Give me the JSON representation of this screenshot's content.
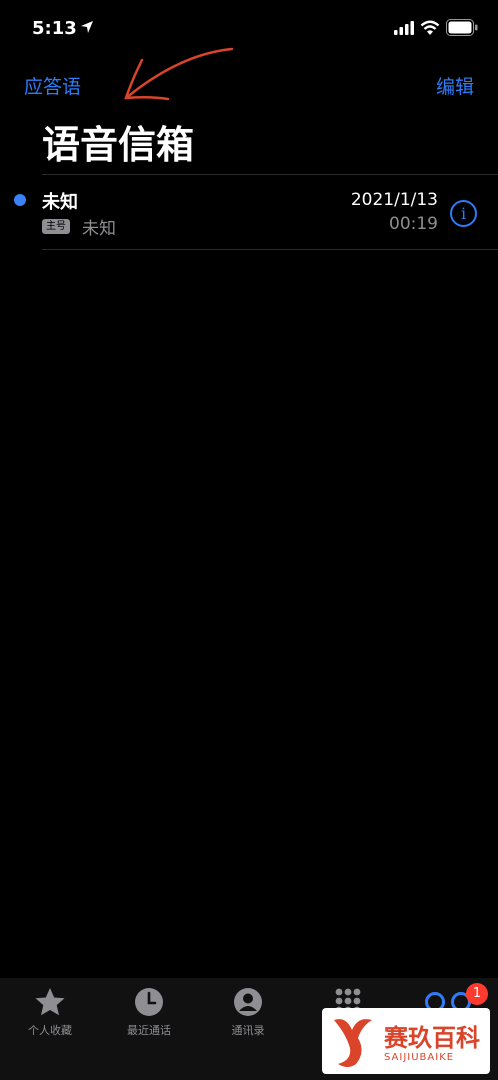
{
  "status_bar": {
    "time": "5:13",
    "icons": [
      "location-icon",
      "cellular-icon",
      "wifi-icon",
      "battery-icon"
    ]
  },
  "nav": {
    "left_label": "应答语",
    "right_label": "编辑"
  },
  "page": {
    "title": "语音信箱"
  },
  "voicemails": [
    {
      "caller": "未知",
      "badge": "主号",
      "subtitle": "未知",
      "date": "2021/1/13",
      "duration": "00:19",
      "unread": true
    }
  ],
  "tabs": [
    {
      "label": "个人收藏",
      "icon": "star-icon"
    },
    {
      "label": "最近通话",
      "icon": "clock-icon"
    },
    {
      "label": "通讯录",
      "icon": "person-icon"
    },
    {
      "label": "",
      "icon": "keypad-icon"
    },
    {
      "label": "",
      "icon": "voicemail-icon",
      "badge": "1"
    }
  ],
  "watermark": {
    "title": "赛玖百科",
    "subtitle": "SAIJIUBAIKE"
  },
  "colors": {
    "accent": "#2f7cf6",
    "unread": "#3b82f6",
    "badge": "#ff3b30",
    "annotation": "#d9442b"
  }
}
